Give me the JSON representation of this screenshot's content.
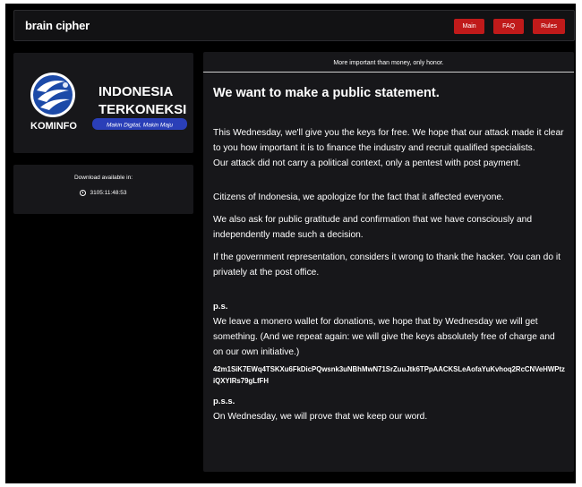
{
  "header": {
    "brand": "brain cipher",
    "nav": [
      "Main",
      "FAQ",
      "Rules"
    ]
  },
  "logo": {
    "line1": "INDONESIA",
    "line2": "TERKONEKSI",
    "brand": "KOMINFO",
    "slogan": "Makin Digital, Makin Maju"
  },
  "download": {
    "label": "Download available in:",
    "timer": "3105:11:48:53"
  },
  "post": {
    "tagline": "More important than money, only honor.",
    "title": "We want to make a public statement.",
    "p1": "This Wednesday, we'll give you the keys for free. We hope that our attack made it clear to you how important it is to finance the industry and recruit qualified specialists.",
    "p2": "Our attack did not carry a political context, only a pentest with post payment.",
    "p3": "Citizens of Indonesia, we apologize for the fact that it affected everyone.",
    "p4": "We also ask for public gratitude and confirmation that we have consciously and independently made such a decision.",
    "p5": "If the government representation, considers it wrong to thank the hacker. You can do it privately at the post office.",
    "ps_label": "p.s.",
    "ps_text": "We leave a monero wallet for donations, we hope that by Wednesday we will get something. (And we repeat again: we will give the keys absolutely free of charge and on our own initiative.)",
    "wallet": "42m1SiK7EWq4TSKXu6FkDicPQwsnk3uNBhMwN71SrZuuJtk6TPpAACKSLeAofaYuKvhoq2RcCNVeHWPtziQXYlRs79gLfFH",
    "pss_label": "p.s.s.",
    "pss_text": "On Wednesday, we will prove that we keep our word."
  },
  "colors": {
    "accent": "#c01a1a",
    "panel": "#17171a",
    "background": "#000000",
    "logo_blue": "#1c4aa8"
  }
}
